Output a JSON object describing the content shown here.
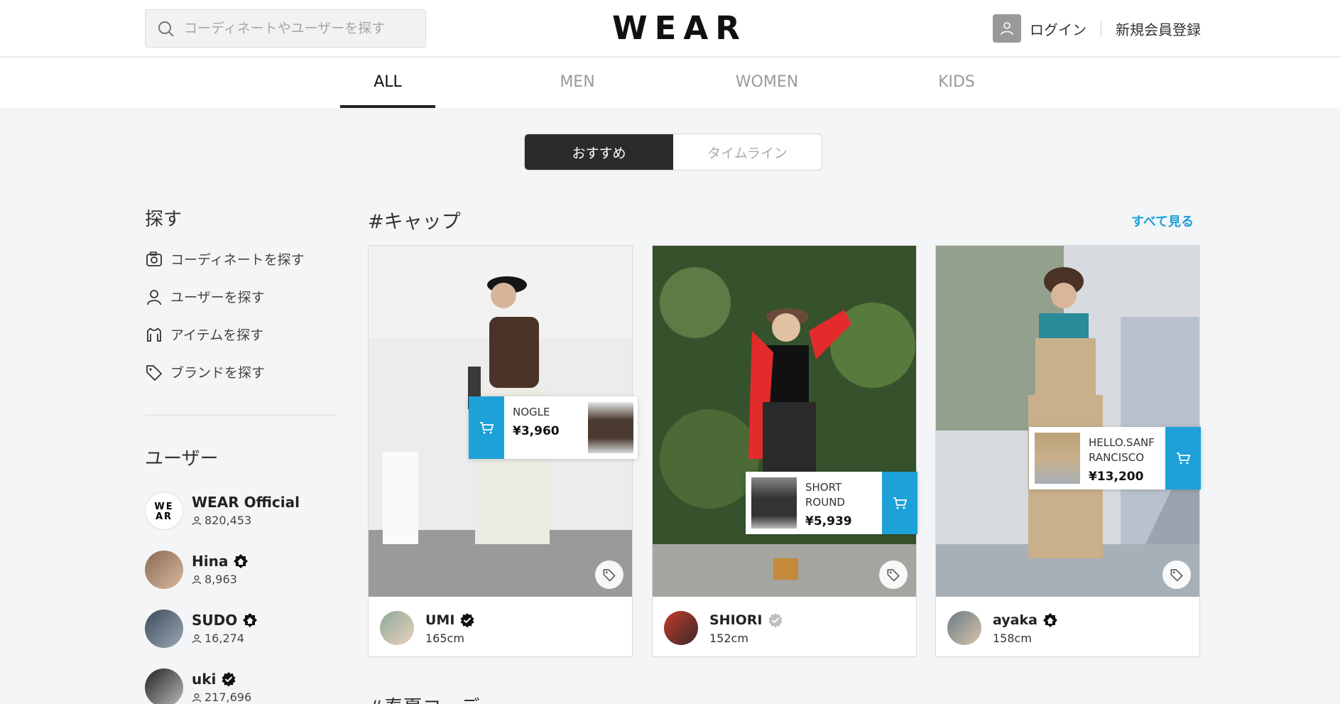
{
  "header": {
    "search_placeholder": "コーディネートやユーザーを探す",
    "logo": "WEAR",
    "login": "ログイン",
    "register": "新規会員登録"
  },
  "gender_tabs": [
    "ALL",
    "MEN",
    "WOMEN",
    "KIDS"
  ],
  "feed_toggle": [
    "おすすめ",
    "タイムライン"
  ],
  "sidebar": {
    "explore_title": "探す",
    "explore_links": [
      {
        "label": "コーディネートを探す",
        "icon": "camera-icon"
      },
      {
        "label": "ユーザーを探す",
        "icon": "person-icon"
      },
      {
        "label": "アイテムを探す",
        "icon": "shirt-icon"
      },
      {
        "label": "ブランドを探す",
        "icon": "tag-icon"
      }
    ],
    "users_title": "ユーザー",
    "users": [
      {
        "name": "WEAR Official",
        "followers": "820,453",
        "badge": "none"
      },
      {
        "name": "Hina",
        "followers": "8,963",
        "badge": "wearista-icon"
      },
      {
        "name": "SUDO",
        "followers": "16,274",
        "badge": "wearista-icon"
      },
      {
        "name": "uki",
        "followers": "217,696",
        "badge": "verified-icon"
      }
    ]
  },
  "section": {
    "title": "#キャップ",
    "see_all": "すべて見る",
    "next_title": "#春夏コーデ"
  },
  "cards": [
    {
      "user": "UMI",
      "height": "165cm",
      "badge": "verified-icon",
      "item_brand": "NOGLE",
      "item_price": "¥3,960"
    },
    {
      "user": "SHIORI",
      "height": "152cm",
      "badge": "verified-grey-icon",
      "item_brand": "SHORT ROUND",
      "item_price": "¥5,939"
    },
    {
      "user": "ayaka",
      "height": "158cm",
      "badge": "wearista-icon",
      "item_brand": "HELLO.SANF RANCISCO",
      "item_price": "¥13,200"
    }
  ],
  "colors": {
    "accent": "#1ea0d8",
    "dark": "#2b2b2b"
  }
}
